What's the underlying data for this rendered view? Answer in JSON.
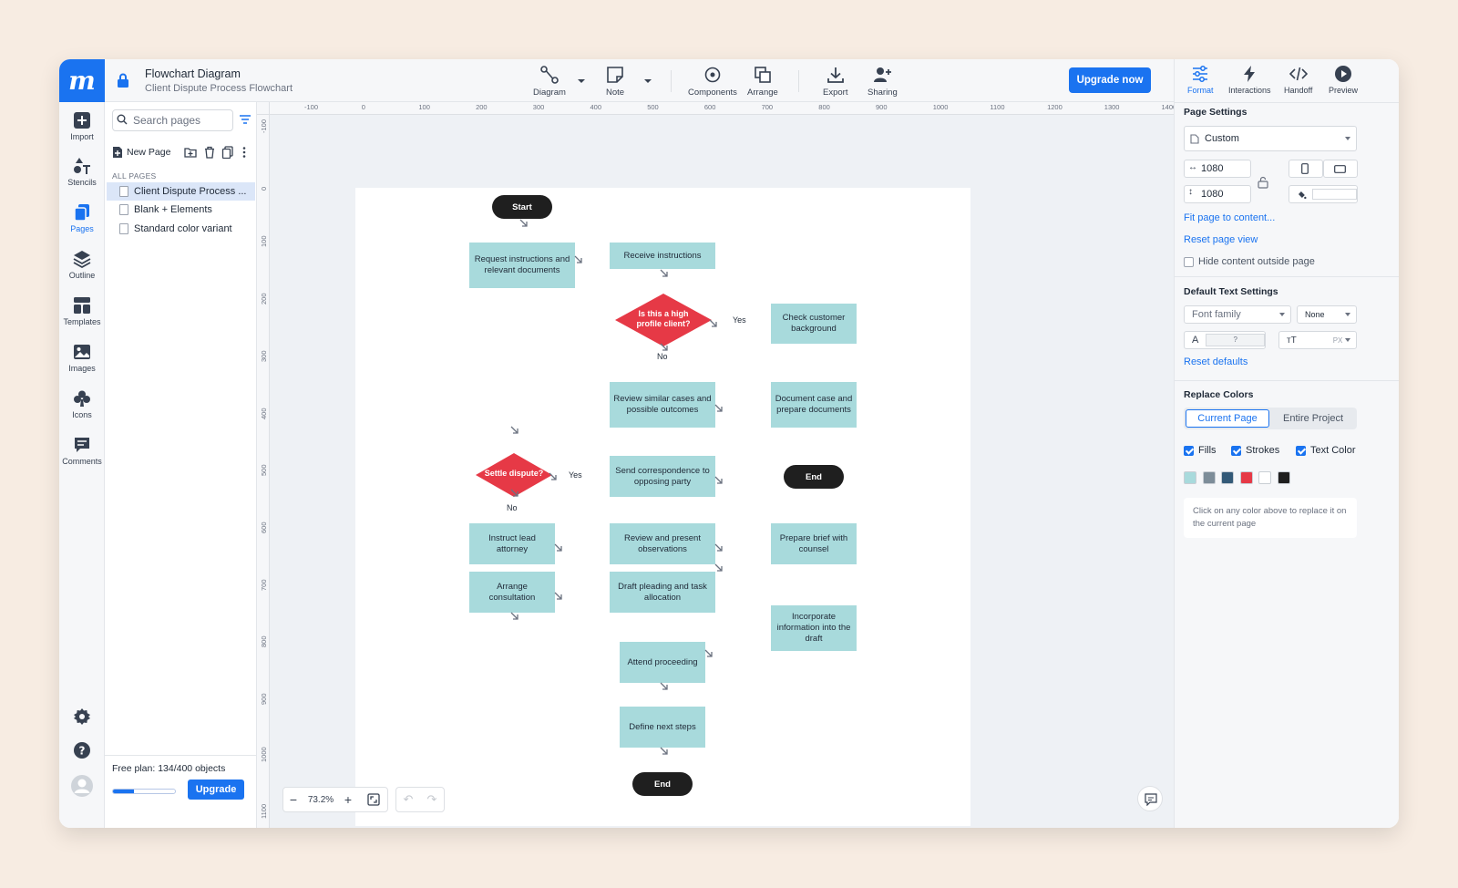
{
  "app": {
    "logo": "m"
  },
  "doc": {
    "title": "Flowchart Diagram",
    "subtitle": "Client Dispute Process Flowchart"
  },
  "toolbar": {
    "tools": [
      {
        "label": "Diagram",
        "icon": "diagram-icon"
      },
      {
        "label": "Note",
        "icon": "note-icon"
      },
      {
        "label": "Components",
        "icon": "components-icon"
      },
      {
        "label": "Arrange",
        "icon": "arrange-icon"
      },
      {
        "label": "Export",
        "icon": "export-icon"
      },
      {
        "label": "Sharing",
        "icon": "sharing-icon"
      }
    ],
    "upgrade_label": "Upgrade now"
  },
  "right_tools": [
    {
      "label": "Format",
      "icon": "format-icon"
    },
    {
      "label": "Interactions",
      "icon": "lightning-icon"
    },
    {
      "label": "Handoff",
      "icon": "code-icon"
    },
    {
      "label": "Preview",
      "icon": "play-icon"
    }
  ],
  "rail": [
    {
      "label": "Import",
      "icon": "plus-icon"
    },
    {
      "label": "Stencils",
      "icon": "shapes-icon"
    },
    {
      "label": "Pages",
      "icon": "pages-icon"
    },
    {
      "label": "Outline",
      "icon": "layers-icon"
    },
    {
      "label": "Templates",
      "icon": "templates-icon"
    },
    {
      "label": "Images",
      "icon": "image-icon"
    },
    {
      "label": "Icons",
      "icon": "club-icon"
    },
    {
      "label": "Comments",
      "icon": "comment-icon"
    }
  ],
  "pages_panel": {
    "search_placeholder": "Search pages",
    "new_page_label": "New Page",
    "section_label": "ALL PAGES",
    "pages": [
      "Client Dispute Process ...",
      "Blank + Elements",
      "Standard color variant"
    ],
    "plan_text": "Free plan: 134/400 objects",
    "plan_used": 134,
    "plan_limit": 400,
    "upgrade_label": "Upgrade"
  },
  "rulers": {
    "h_ticks": [
      "-100",
      "0",
      "100",
      "200",
      "300",
      "400",
      "500",
      "600",
      "700",
      "800",
      "900",
      "1000",
      "1100",
      "1200",
      "1300",
      "1400"
    ],
    "v_ticks": [
      "-100",
      "0",
      "100",
      "200",
      "300",
      "400",
      "500",
      "600",
      "700",
      "800",
      "900",
      "1000",
      "1100"
    ]
  },
  "diagram": {
    "start": "Start",
    "end_1": "End",
    "end_2": "End",
    "request": "Request instructions and relevant documents",
    "receive": "Receive instructions",
    "high_profile": "Is this a high profile client?",
    "yes_1": "Yes",
    "no_1": "No",
    "check_bg": "Check customer background",
    "review_cases": "Review similar cases and possible outcomes",
    "document_case": "Document case and prepare documents",
    "settle": "Settle dispute?",
    "yes_2": "Yes",
    "no_2": "No",
    "send_corr": "Send correspondence to opposing party",
    "instruct": "Instruct lead attorney",
    "review_obs": "Review and present observations",
    "prepare_brief": "Prepare brief with counsel",
    "arrange": "Arrange consultation",
    "draft": "Draft pleading and task allocation",
    "incorporate": "Incorporate information into the draft",
    "attend": "Attend proceeding",
    "define": "Define next steps"
  },
  "zoom": {
    "value": "73.2%",
    "minus": "−",
    "plus": "+"
  },
  "format_panel": {
    "page_settings_title": "Page Settings",
    "page_size": "Custom",
    "width": "1080",
    "height": "1080",
    "fit_link": "Fit page to content...",
    "reset_view_link": "Reset page view",
    "hide_outside": "Hide content outside page",
    "text_settings_title": "Default Text Settings",
    "font_family_placeholder": "Font family",
    "text_style": "None",
    "font_size": "?",
    "size_unit": "PX",
    "reset_defaults": "Reset defaults",
    "replace_colors_title": "Replace Colors",
    "tab_current": "Current Page",
    "tab_entire": "Entire Project",
    "fills": "Fills",
    "strokes": "Strokes",
    "text_color": "Text Color",
    "swatches": [
      "#a8dadc",
      "#7d8d99",
      "#345a78",
      "#e63946",
      "#ffffff",
      "#1f1f1f"
    ],
    "hint": "Click on any color above to replace it on the current page"
  },
  "colors": {
    "accent": "#1a73f0",
    "node_fill": "#a8dadc",
    "decision_fill": "#e63946",
    "terminal_fill": "#1f1f1f"
  }
}
